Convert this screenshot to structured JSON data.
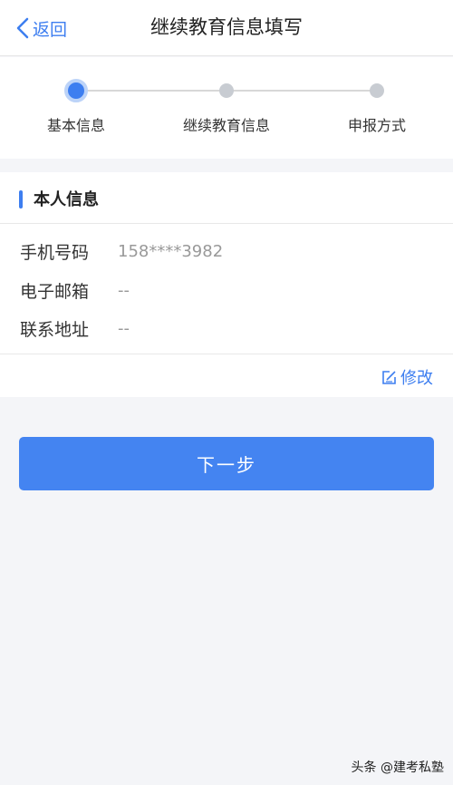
{
  "header": {
    "back_label": "返回",
    "title": "继续教育信息填写"
  },
  "steps": [
    {
      "label": "基本信息",
      "active": true
    },
    {
      "label": "继续教育信息",
      "active": false
    },
    {
      "label": "申报方式",
      "active": false
    }
  ],
  "section": {
    "title": "本人信息",
    "rows": [
      {
        "label": "手机号码",
        "value": "158****3982"
      },
      {
        "label": "电子邮箱",
        "value": "--"
      },
      {
        "label": "联系地址",
        "value": "--"
      }
    ],
    "edit_label": "修改"
  },
  "next_button_label": "下一步",
  "watermark": "头条 @建考私塾",
  "colors": {
    "accent": "#3d7ef0",
    "button": "#4484f1",
    "background": "#f4f5f8"
  }
}
